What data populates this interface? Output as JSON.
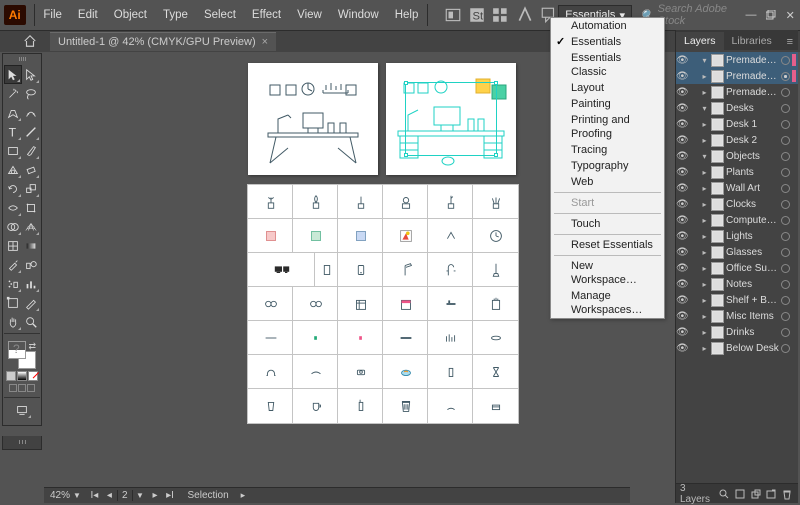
{
  "app": {
    "logo_text": "Ai"
  },
  "menu": [
    "File",
    "Edit",
    "Object",
    "Type",
    "Select",
    "Effect",
    "View",
    "Window",
    "Help"
  ],
  "workspace": {
    "current": "Essentials",
    "items": [
      {
        "label": "Automation",
        "checked": false
      },
      {
        "label": "Essentials",
        "checked": true
      },
      {
        "label": "Essentials Classic",
        "checked": false
      },
      {
        "label": "Layout",
        "checked": false
      },
      {
        "label": "Painting",
        "checked": false
      },
      {
        "label": "Printing and Proofing",
        "checked": false
      },
      {
        "label": "Tracing",
        "checked": false
      },
      {
        "label": "Typography",
        "checked": false
      },
      {
        "label": "Web",
        "checked": false
      }
    ],
    "start": "Start",
    "touch": "Touch",
    "reset": "Reset Essentials",
    "new": "New Workspace…",
    "manage": "Manage Workspaces…"
  },
  "search": {
    "placeholder": "Search Adobe Stock"
  },
  "document": {
    "tab_title": "Untitled-1 @ 42% (CMYK/GPU Preview)"
  },
  "status": {
    "zoom": "42%",
    "artboard_current": "2",
    "tool": "Selection"
  },
  "panel": {
    "tabs": [
      "Layers",
      "Libraries"
    ],
    "active": "Layers",
    "footer_info": "3 Layers",
    "layers": [
      {
        "name": "Premade Scenes",
        "depth": 0,
        "open": true,
        "color": "cs-rose",
        "sel": true
      },
      {
        "name": "Premade …",
        "depth": 1,
        "open": false,
        "color": "cs-rose",
        "sel": true,
        "target": true
      },
      {
        "name": "Premade …",
        "depth": 1,
        "open": false,
        "color": "cs-rose"
      },
      {
        "name": "Desks",
        "depth": 0,
        "open": true,
        "color": "cs-violet"
      },
      {
        "name": "Desk 1",
        "depth": 1,
        "open": false,
        "color": "cs-violet"
      },
      {
        "name": "Desk 2",
        "depth": 1,
        "open": false,
        "color": "cs-violet"
      },
      {
        "name": "Objects",
        "depth": 0,
        "open": true,
        "color": "cs-mag"
      },
      {
        "name": "Plants",
        "depth": 1,
        "open": false,
        "color": "cs-mag"
      },
      {
        "name": "Wall Art",
        "depth": 1,
        "open": false,
        "color": "cs-mag"
      },
      {
        "name": "Clocks",
        "depth": 1,
        "open": false,
        "color": "cs-mag"
      },
      {
        "name": "Computer…",
        "depth": 1,
        "open": false,
        "color": "cs-mag"
      },
      {
        "name": "Lights",
        "depth": 1,
        "open": false,
        "color": "cs-mag"
      },
      {
        "name": "Glasses",
        "depth": 1,
        "open": false,
        "color": "cs-mag"
      },
      {
        "name": "Office Su…",
        "depth": 1,
        "open": false,
        "color": "cs-mag"
      },
      {
        "name": "Notes",
        "depth": 1,
        "open": false,
        "color": "cs-mag"
      },
      {
        "name": "Shelf + B…",
        "depth": 1,
        "open": false,
        "color": "cs-mag"
      },
      {
        "name": "Misc Items",
        "depth": 1,
        "open": false,
        "color": "cs-mag"
      },
      {
        "name": "Drinks",
        "depth": 1,
        "open": false,
        "color": "cs-mag"
      },
      {
        "name": "Below Desk",
        "depth": 1,
        "open": false,
        "color": "cs-mag"
      }
    ]
  }
}
